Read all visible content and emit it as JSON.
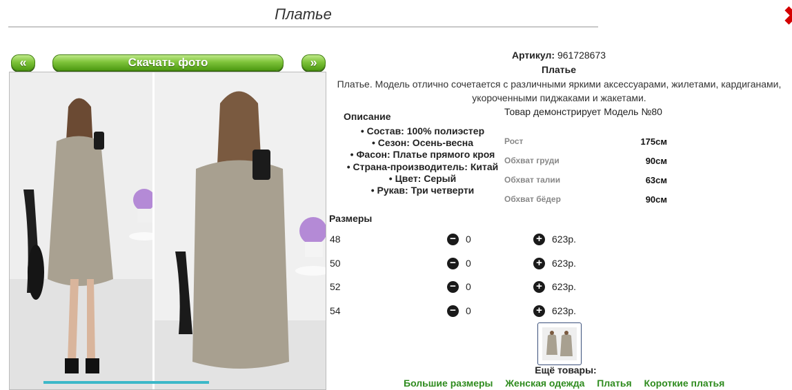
{
  "page": {
    "title": "Платье"
  },
  "gallery": {
    "prev_label": "«",
    "next_label": "»",
    "download_label": "Скачать фото"
  },
  "product": {
    "article_label": "Артикул:",
    "article_value": "961728673",
    "name": "Платье",
    "description_line1": "Платье. Модель отлично сочетается с различными яркими аксессуарами, жилетами, кардиганами,",
    "description_line2": "укороченными пиджаками и жакетами.",
    "description_heading": "Описание",
    "specs": [
      "Состав: 100% полиэстер",
      "Сезон: Осень-весна",
      "Фасон: Платье прямого кроя",
      "Страна-производитель: Китай",
      "Цвет: Серый",
      "Рукав: Три четверти"
    ]
  },
  "model": {
    "title": "Товар демонстрирует Модель №80",
    "measurements": [
      {
        "label": "Рост",
        "value": "175см"
      },
      {
        "label": "Обхват груди",
        "value": "90см"
      },
      {
        "label": "Обхват талии",
        "value": "63см"
      },
      {
        "label": "Обхват бёдер",
        "value": "90см"
      }
    ]
  },
  "sizes": {
    "heading": "Размеры",
    "rows": [
      {
        "size": "48",
        "qty": "0",
        "price": "623р."
      },
      {
        "size": "50",
        "qty": "0",
        "price": "623р."
      },
      {
        "size": "52",
        "qty": "0",
        "price": "623р."
      },
      {
        "size": "54",
        "qty": "0",
        "price": "623р."
      }
    ]
  },
  "more": {
    "heading": "Ещё товары:",
    "links": [
      "Большие размеры",
      "Женская одежда",
      "Платья",
      "Короткие платья"
    ]
  },
  "colors": {
    "button_green": "#6db52a",
    "close_red": "#d40000",
    "link_green": "#2e8b1e"
  }
}
